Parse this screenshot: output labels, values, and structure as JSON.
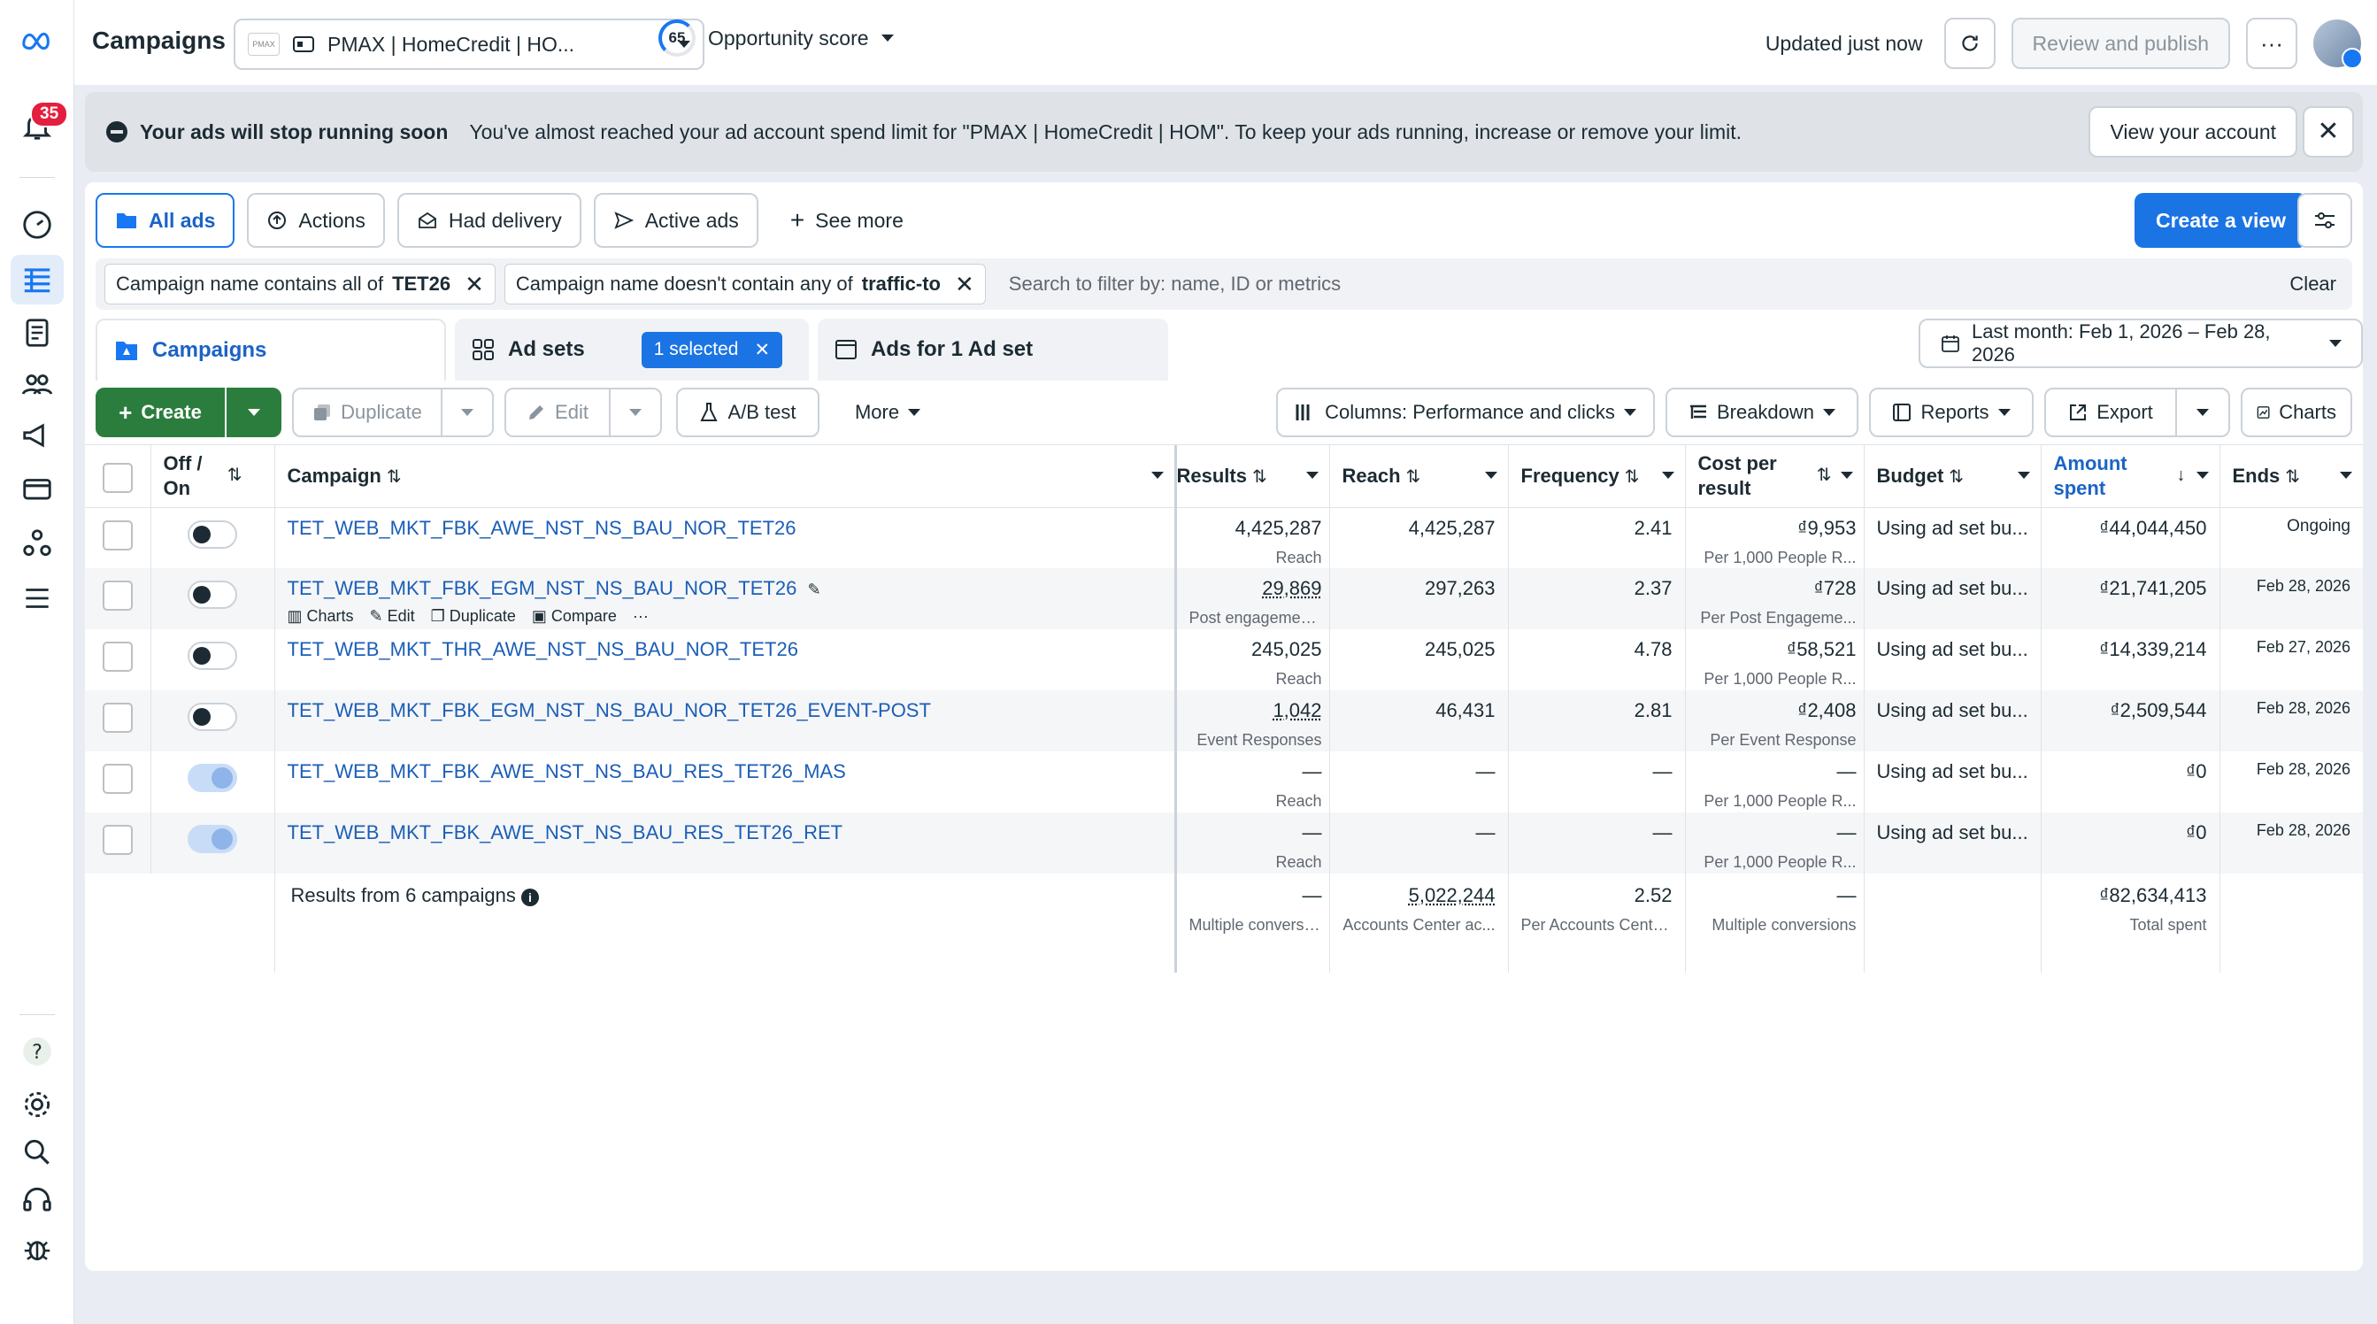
{
  "sidebar": {
    "notification_count": "35"
  },
  "header": {
    "title": "Campaigns",
    "account_name": "PMAX | HomeCredit | HO...",
    "account_logo_text": "PMAX",
    "opportunity_score": "65",
    "opportunity_label": "Opportunity score",
    "updated_text": "Updated just now",
    "review_publish": "Review and publish"
  },
  "alert": {
    "title": "Your ads will stop running soon",
    "message": "You've almost reached your ad account spend limit for \"PMAX | HomeCredit | HOM\". To keep your ads running, increase or remove your limit.",
    "action": "View your account"
  },
  "filter_tabs": [
    {
      "label": "All ads"
    },
    {
      "label": "Actions"
    },
    {
      "label": "Had delivery"
    },
    {
      "label": "Active ads"
    },
    {
      "label": "See more"
    }
  ],
  "create_view": "Create a view",
  "filters": [
    {
      "prefix": "Campaign name contains all of",
      "value": "TET26"
    },
    {
      "prefix": "Campaign name doesn't contain any of",
      "value": "traffic-to"
    }
  ],
  "search_placeholder": "Search to filter by: name, ID or metrics",
  "clear": "Clear",
  "level_tabs": {
    "campaigns": "Campaigns",
    "ad_sets": "Ad sets",
    "selected": "1 selected",
    "ads": "Ads for 1 Ad set"
  },
  "date_range": "Last month: Feb 1, 2026 – Feb 28, 2026",
  "toolbar": {
    "create": "Create",
    "duplicate": "Duplicate",
    "edit": "Edit",
    "ab_test": "A/B test",
    "more": "More",
    "columns": "Columns: Performance and clicks",
    "breakdown": "Breakdown",
    "reports": "Reports",
    "export": "Export",
    "charts": "Charts"
  },
  "columns": {
    "off_on": "Off / On",
    "campaign": "Campaign",
    "results": "Results",
    "reach": "Reach",
    "frequency": "Frequency",
    "cost_per_result": "Cost per result",
    "budget": "Budget",
    "amount_spent": "Amount spent",
    "ends": "Ends"
  },
  "row_actions": {
    "charts": "Charts",
    "edit": "Edit",
    "duplicate": "Duplicate",
    "compare": "Compare"
  },
  "rows": [
    {
      "campaign": "TET_WEB_MKT_FBK_AWE_NST_NS_BAU_NOR_TET26",
      "on": true,
      "results": "4,425,287",
      "results_sub": "Reach",
      "reach": "4,425,287",
      "frequency": "2.41",
      "cost": "₫9,953",
      "cost_sub": "Per 1,000 People R...",
      "budget": "Using ad set bu...",
      "spent": "₫44,044,450",
      "ends": "Ongoing"
    },
    {
      "campaign": "TET_WEB_MKT_FBK_EGM_NST_NS_BAU_NOR_TET26",
      "on": true,
      "results": "29,869",
      "results_sub": "Post engagements",
      "reach": "297,263",
      "frequency": "2.37",
      "cost": "₫728",
      "cost_sub": "Per Post Engageme...",
      "budget": "Using ad set bu...",
      "spent": "₫21,741,205",
      "ends": "Feb 28, 2026"
    },
    {
      "campaign": "TET_WEB_MKT_THR_AWE_NST_NS_BAU_NOR_TET26",
      "on": true,
      "results": "245,025",
      "results_sub": "Reach",
      "reach": "245,025",
      "frequency": "4.78",
      "cost": "₫58,521",
      "cost_sub": "Per 1,000 People R...",
      "budget": "Using ad set bu...",
      "spent": "₫14,339,214",
      "ends": "Feb 27, 2026"
    },
    {
      "campaign": "TET_WEB_MKT_FBK_EGM_NST_NS_BAU_NOR_TET26_EVENT-POST",
      "on": true,
      "results": "1,042",
      "results_sub": "Event Responses",
      "reach": "46,431",
      "frequency": "2.81",
      "cost": "₫2,408",
      "cost_sub": "Per Event Response",
      "budget": "Using ad set bu...",
      "spent": "₫2,509,544",
      "ends": "Feb 28, 2026"
    },
    {
      "campaign": "TET_WEB_MKT_FBK_AWE_NST_NS_BAU_RES_TET26_MAS",
      "on": false,
      "results": "—",
      "results_sub": "Reach",
      "reach": "—",
      "frequency": "—",
      "cost": "—",
      "cost_sub": "Per 1,000 People R...",
      "budget": "Using ad set bu...",
      "spent": "₫0",
      "ends": "Feb 28, 2026"
    },
    {
      "campaign": "TET_WEB_MKT_FBK_AWE_NST_NS_BAU_RES_TET26_RET",
      "on": false,
      "results": "—",
      "results_sub": "Reach",
      "reach": "—",
      "frequency": "—",
      "cost": "—",
      "cost_sub": "Per 1,000 People R...",
      "budget": "Using ad set bu...",
      "spent": "₫0",
      "ends": "Feb 28, 2026"
    }
  ],
  "totals": {
    "label": "Results from 6 campaigns",
    "results": "—",
    "results_sub": "Multiple conversions",
    "reach": "5,022,244",
    "reach_sub": "Accounts Center ac...",
    "frequency": "2.52",
    "frequency_sub": "Per Accounts Cente...",
    "cost": "—",
    "cost_sub": "Multiple conversions",
    "spent": "₫82,634,413",
    "spent_sub": "Total spent"
  }
}
